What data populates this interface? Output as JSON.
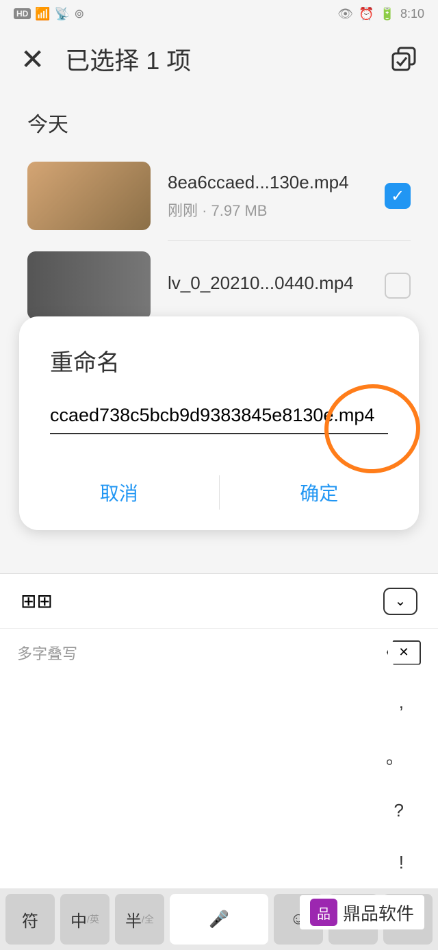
{
  "status": {
    "time": "8:10"
  },
  "header": {
    "title": "已选择 1 项"
  },
  "section": {
    "today": "今天"
  },
  "files": [
    {
      "name": "8ea6ccaed...130e.mp4",
      "meta": "刚刚 · 7.97 MB",
      "checked": true
    },
    {
      "name": "lv_0_20210...0440.mp4",
      "meta": "",
      "checked": false
    }
  ],
  "dialog": {
    "title": "重命名",
    "input_value": "ccaed738c5bcb9d9383845e8130e.mp4",
    "cancel": "取消",
    "confirm": "确定"
  },
  "keyboard": {
    "candidate": "多字叠写",
    "symbols": [
      ",",
      "。",
      "?",
      "!"
    ],
    "keys": {
      "sym": "符",
      "zh": "中",
      "zh_sub": "/英",
      "half": "半",
      "half_sub": "/全"
    }
  },
  "watermark": {
    "text": "鼎品软件"
  }
}
